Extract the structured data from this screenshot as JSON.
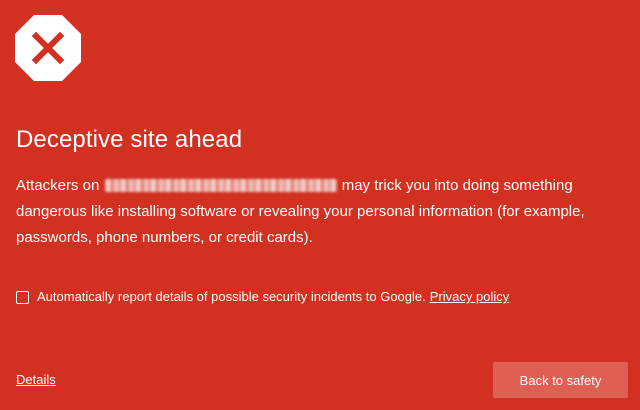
{
  "icon": {
    "name": "warning-octagon-icon",
    "badge_color": "#ffffff",
    "cross_color": "#D23122"
  },
  "title": "Deceptive site ahead",
  "message": {
    "prefix": "Attackers on",
    "suffix": "may trick you into doing something dangerous like installing software or revealing your personal information (for example, passwords, phone numbers, or credit cards)."
  },
  "report": {
    "checked": false,
    "label": "Automatically report details of possible security incidents to Google.",
    "privacy_link": "Privacy policy"
  },
  "footer": {
    "details_link": "Details",
    "back_button": "Back to safety"
  },
  "colors": {
    "background": "#D23122",
    "button": "#DF5F53",
    "text": "#ffffff"
  }
}
